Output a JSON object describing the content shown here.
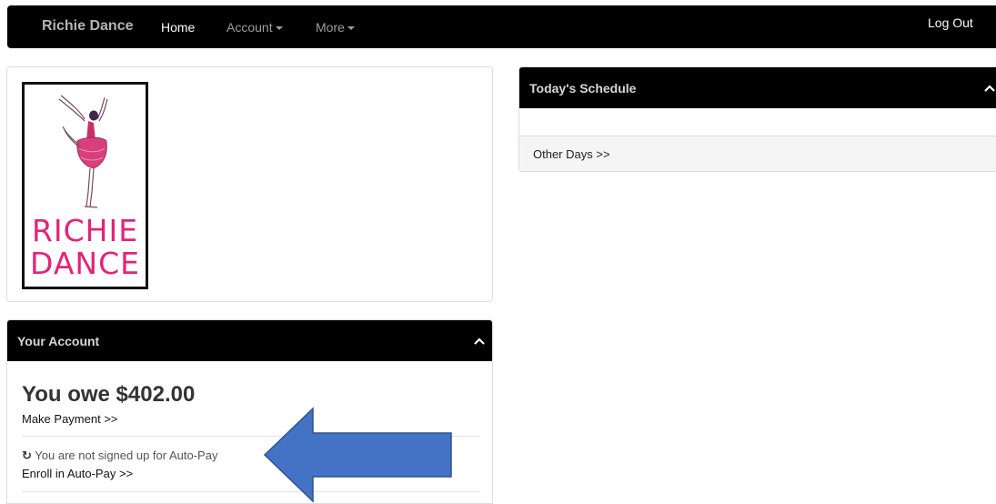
{
  "navbar": {
    "brand": "Richie Dance",
    "home": "Home",
    "account": "Account",
    "more": "More",
    "logout": "Log Out"
  },
  "logo": {
    "line1": "RICHIE",
    "line2": "DANCE",
    "accent_color": "#e3237a"
  },
  "account_panel": {
    "title": "Your Account",
    "owe_text": "You owe $402.00",
    "make_payment": "Make Payment >>",
    "autopay_status": "You are not signed up for Auto-Pay",
    "enroll_link": "Enroll in Auto-Pay >>"
  },
  "schedule_panel": {
    "title": "Today's Schedule",
    "other_days": "Other Days >>"
  },
  "annotation": {
    "arrow_color": "#4472c4"
  }
}
